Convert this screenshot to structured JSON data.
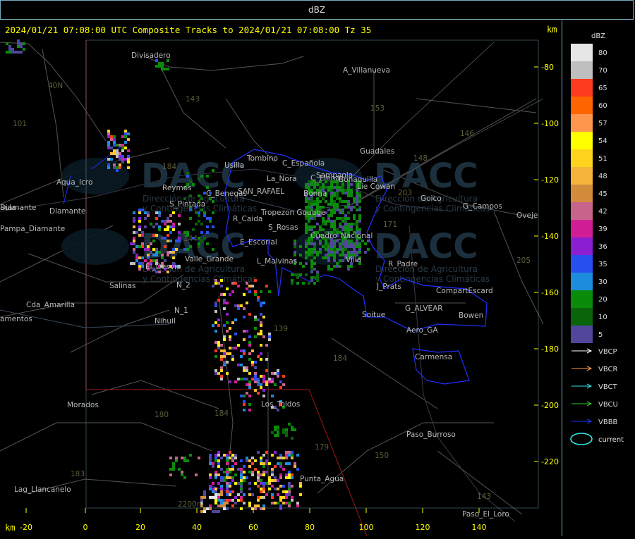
{
  "header": {
    "title": "dBZ"
  },
  "map": {
    "title": "2024/01/21 07:08:00 UTC Composite Tracks to 2024/01/21 07:08:00 Tz 35",
    "unit": "km",
    "y_ticks": [
      "-80",
      "-100",
      "-120",
      "-140",
      "-160",
      "-180",
      "-200",
      "-220"
    ],
    "x_ticks": [
      "-20",
      "0",
      "20",
      "40",
      "60",
      "80",
      "100",
      "120",
      "140"
    ],
    "watermark": "DACC",
    "watermark_sub": [
      "Dirección de Agricultura",
      "y Contingencias Climáticas"
    ],
    "places": [
      "Divisadero",
      "A_Villanueva",
      "Guadales",
      "Tombino",
      "Usilla",
      "C_Española",
      "La_Nora",
      "C_Elena",
      "Bonaquilla",
      "Lie Cowan",
      "SAN_RAFAEL",
      "Bonna",
      "Reymos",
      "S_Pintada",
      "C_Benegas",
      "Goico",
      "G_Campos",
      "Oveje",
      "R_Caida",
      "Tropezon Goudge",
      "S_Rosas",
      "Cuadro_Nacional",
      "E_Escorial",
      "L_Malvinas",
      "Valle_Grande",
      "El_Desvio",
      "Salinas",
      "Cda_Amarilla",
      "Aqua_Icro",
      "Pampa_Diamante",
      "Villa",
      "Sampaola",
      "R_Padre",
      "J_Prats",
      "CompartEscard",
      "G_ALVEAR",
      "Soitue",
      "Bowen",
      "Aero_GA",
      "Carmensa",
      "Los_Toldos",
      "Morados",
      "Paso_Burroso",
      "Punta_Agua",
      "Lag_Llancanelo",
      "Paso_El_Loro",
      "Nihuil",
      "N_1",
      "N_2",
      "Dlamante",
      "Diamante",
      "amentos",
      "aula",
      "101",
      "40N",
      "143",
      "153",
      "146",
      "148",
      "203",
      "171",
      "144",
      "139",
      "184",
      "180",
      "184",
      "179",
      "150",
      "183",
      "205",
      "143",
      "2200m",
      "184"
    ]
  },
  "legend": {
    "title": "dBZ",
    "scale": [
      {
        "label": "80",
        "color": "#e6e6e6"
      },
      {
        "label": "70",
        "color": "#bfbfbf"
      },
      {
        "label": "65",
        "color": "#ff3a1e"
      },
      {
        "label": "60",
        "color": "#ff6400"
      },
      {
        "label": "57",
        "color": "#ff9650"
      },
      {
        "label": "54",
        "color": "#ffff00"
      },
      {
        "label": "51",
        "color": "#ffd21e"
      },
      {
        "label": "48",
        "color": "#f5b43c"
      },
      {
        "label": "45",
        "color": "#d28c3c"
      },
      {
        "label": "42",
        "color": "#c8648c"
      },
      {
        "label": "39",
        "color": "#d21e96"
      },
      {
        "label": "36",
        "color": "#8c1ed2"
      },
      {
        "label": "35",
        "color": "#2850f0"
      },
      {
        "label": "30",
        "color": "#1e8cdc"
      },
      {
        "label": "20",
        "color": "#0a8c0a"
      },
      {
        "label": "10",
        "color": "#0a640a"
      },
      {
        "label": "5",
        "color": "#50469b"
      }
    ],
    "tracks": [
      {
        "label": "VBCP",
        "color": "#ffffff"
      },
      {
        "label": "VBCR",
        "color": "#ff9650"
      },
      {
        "label": "VBCT",
        "color": "#32e6e6"
      },
      {
        "label": "VBCU",
        "color": "#32c832"
      },
      {
        "label": "VBBB",
        "color": "#1e32ff"
      }
    ],
    "current": {
      "label": "current",
      "color": "#32e6e6"
    }
  }
}
